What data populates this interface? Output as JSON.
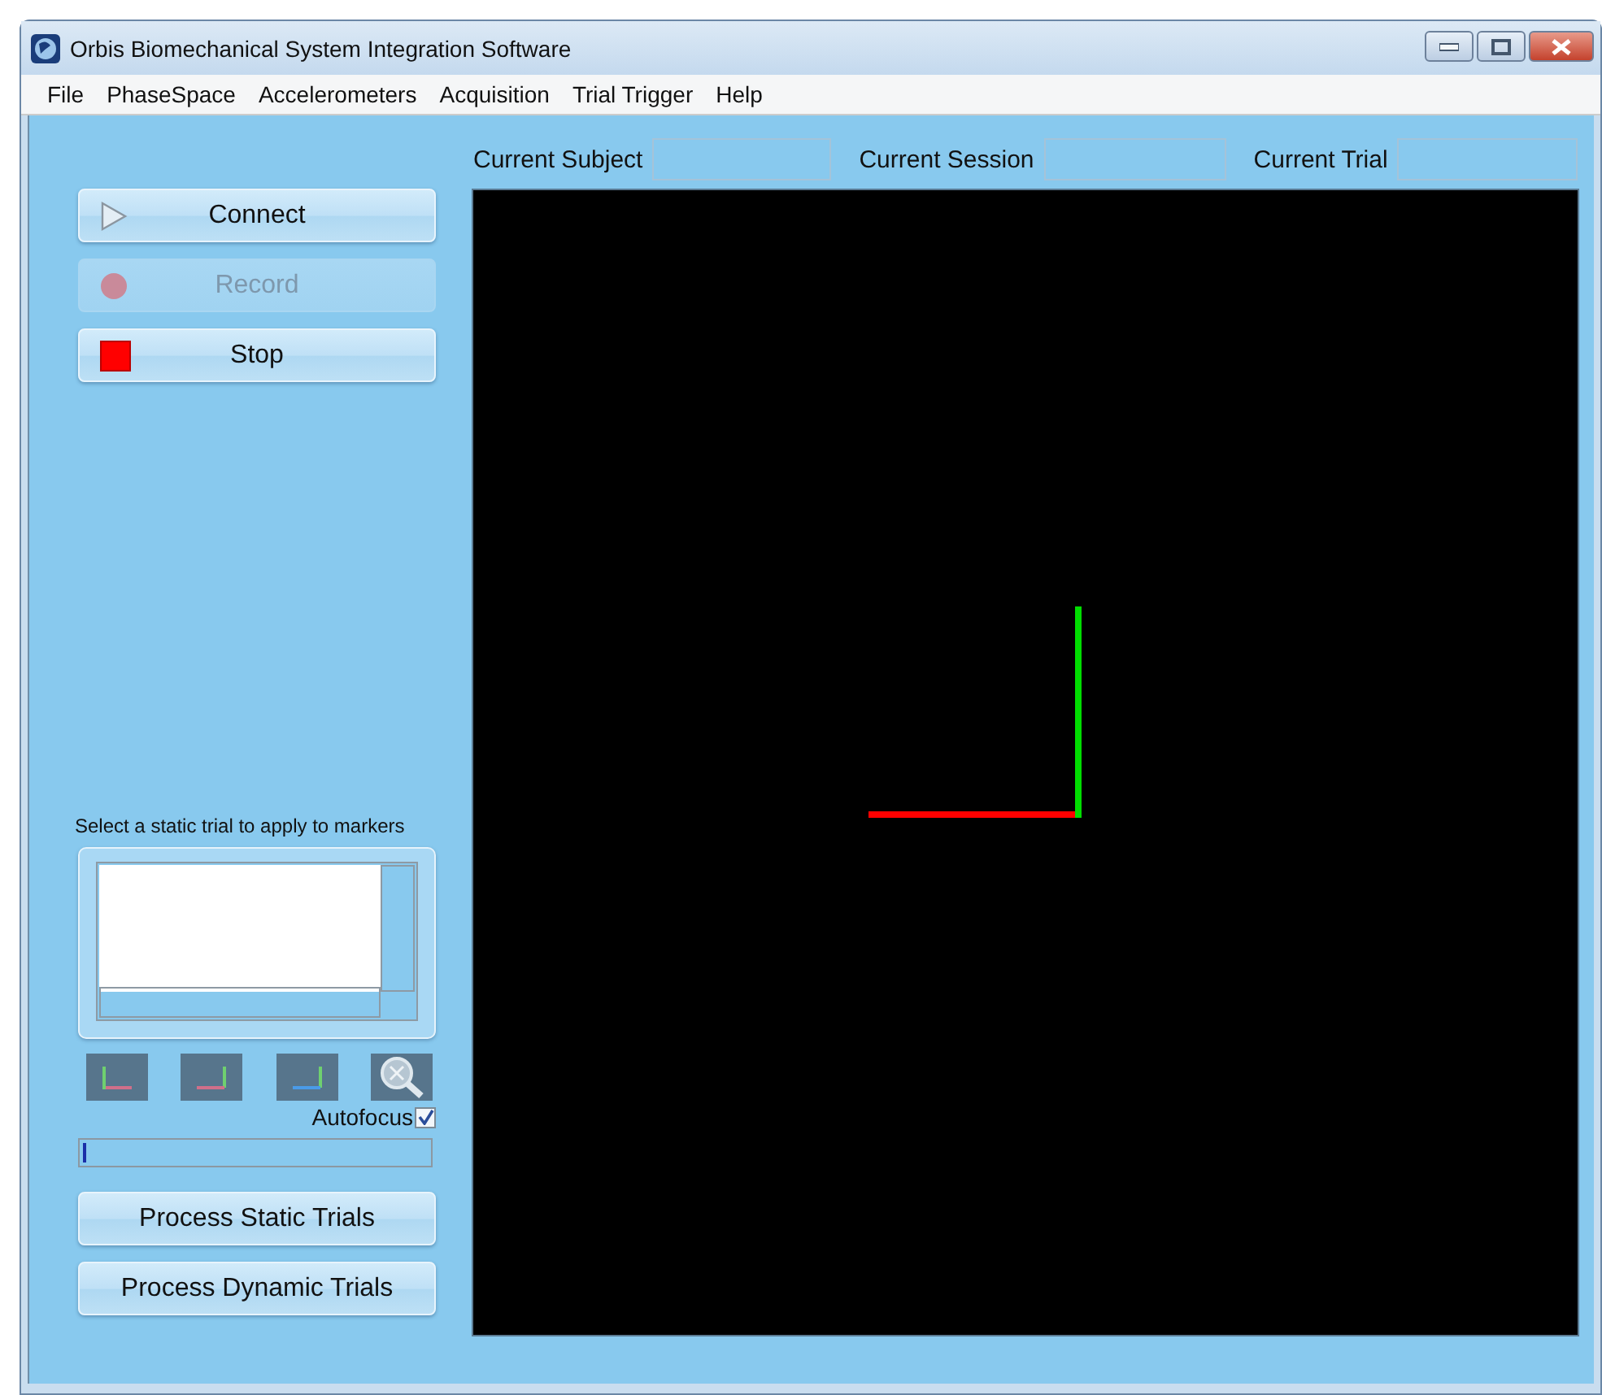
{
  "window": {
    "title": "Orbis Biomechanical System Integration Software"
  },
  "menu": [
    "File",
    "PhaseSpace",
    "Accelerometers",
    "Acquisition",
    "Trial Trigger",
    "Help"
  ],
  "controls": [
    {
      "label": "Connect",
      "kind": "play",
      "disabled": false
    },
    {
      "label": "Record",
      "kind": "record",
      "disabled": true
    },
    {
      "label": "Stop",
      "kind": "stop",
      "disabled": false
    }
  ],
  "fields": [
    {
      "label": "Current Subject"
    },
    {
      "label": "Current Session"
    },
    {
      "label": "Current Trial"
    }
  ],
  "static_trial_prompt": "Select a static trial to apply to markers",
  "autofocus": {
    "label": "Autofocus",
    "checked": true
  },
  "progress": {
    "level": 0.01
  },
  "process_buttons": [
    "Process Static Trials",
    "Process Dynamic Trials"
  ]
}
